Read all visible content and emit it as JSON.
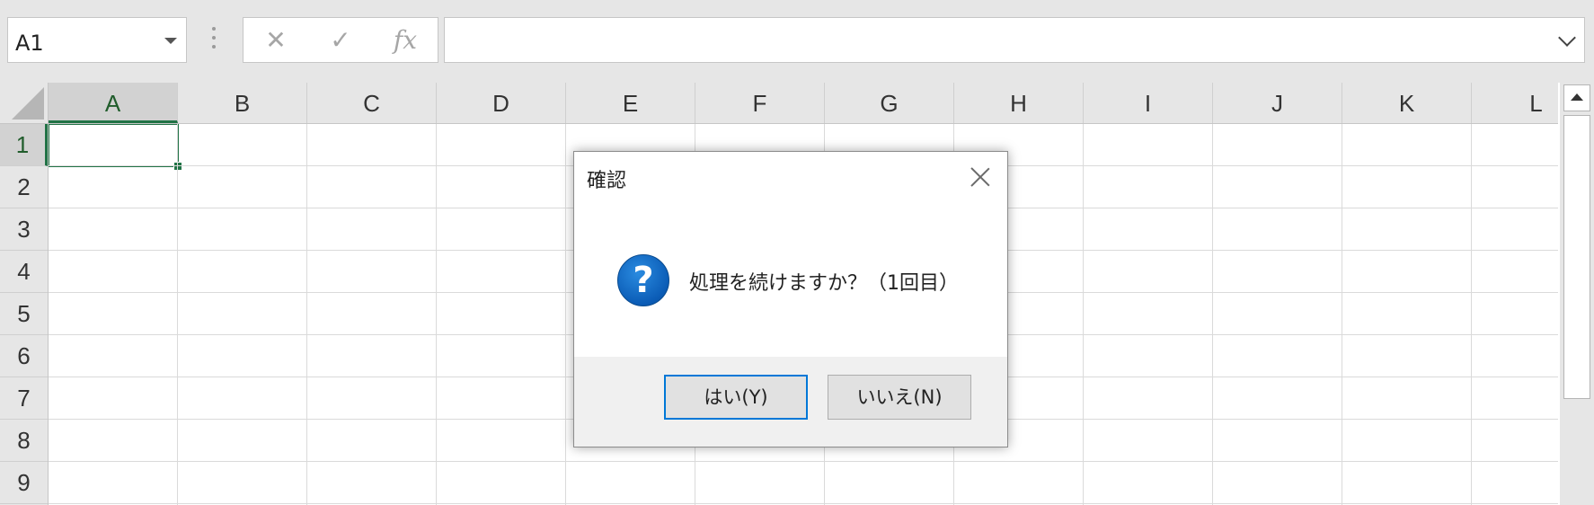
{
  "formula_bar": {
    "name_box": "A1",
    "cancel_symbol": "✕",
    "enter_symbol": "✓",
    "fx_label": "fx",
    "formula_value": ""
  },
  "grid": {
    "columns": [
      "A",
      "B",
      "C",
      "D",
      "E",
      "F",
      "G",
      "H",
      "I",
      "J",
      "K",
      "L"
    ],
    "rows": [
      "1",
      "2",
      "3",
      "4",
      "5",
      "6",
      "7",
      "8",
      "9"
    ],
    "active_cell": "A1",
    "accent_color": "#217346"
  },
  "dialog": {
    "title": "確認",
    "message": "処理を続けますか？（1回目）",
    "icon": "question-icon",
    "buttons": {
      "yes": "はい(Y)",
      "no": "いいえ(N)"
    }
  },
  "icons": {
    "name_box_dropdown": "chevron-down-icon",
    "formula_expand": "chevron-down-icon",
    "close": "close-icon",
    "scroll_up": "arrow-up-icon"
  }
}
